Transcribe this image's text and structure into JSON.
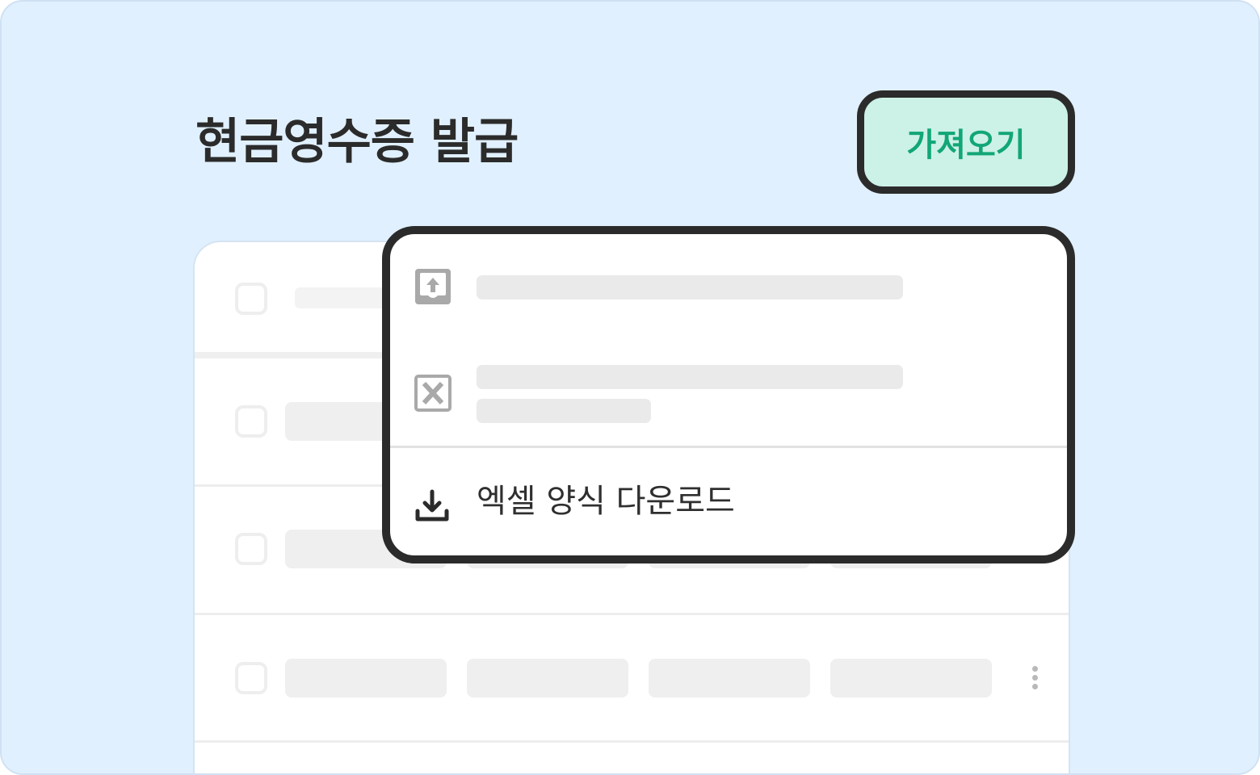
{
  "header": {
    "title": "현금영수증 발급",
    "import_button_label": "가져오기"
  },
  "dropdown": {
    "items": [
      {
        "icon": "upload-tray-icon",
        "label": ""
      },
      {
        "icon": "excel-file-icon",
        "label": ""
      }
    ],
    "download_label": "엑셀 양식 다운로드",
    "download_icon": "download-icon"
  },
  "list": {
    "rows": 4,
    "row_menu_icon": "kebab-menu-icon"
  },
  "colors": {
    "background": "#e0f0fe",
    "accent_green": "#12a677",
    "button_fill": "#ccf1e6",
    "outline": "#2b2b2b"
  }
}
